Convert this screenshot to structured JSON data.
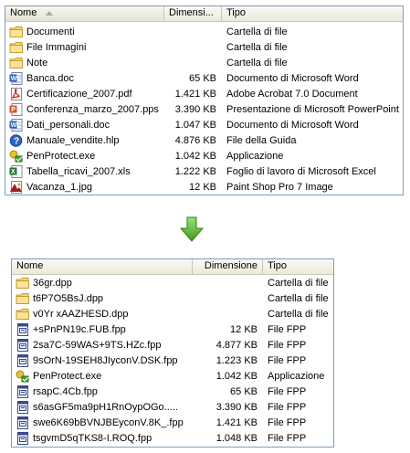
{
  "top": {
    "columns": {
      "name": "Nome",
      "size": "Dimensi...",
      "type": "Tipo"
    },
    "rows": [
      {
        "icon": "folder-icon",
        "name": "Documenti",
        "size": "",
        "type": "Cartella di file"
      },
      {
        "icon": "folder-icon",
        "name": "File Immagini",
        "size": "",
        "type": "Cartella di file"
      },
      {
        "icon": "folder-icon",
        "name": "Note",
        "size": "",
        "type": "Cartella di file"
      },
      {
        "icon": "word-doc-icon",
        "name": "Banca.doc",
        "size": "65 KB",
        "type": "Documento di Microsoft Word"
      },
      {
        "icon": "pdf-icon",
        "name": "Certificazione_2007.pdf",
        "size": "1.421 KB",
        "type": "Adobe Acrobat 7.0 Document"
      },
      {
        "icon": "powerpoint-icon",
        "name": "Conferenza_marzo_2007.pps",
        "size": "3.390 KB",
        "type": "Presentazione di Microsoft PowerPoint"
      },
      {
        "icon": "word-doc-icon",
        "name": "Dati_personali.doc",
        "size": "1.047 KB",
        "type": "Documento di Microsoft Word"
      },
      {
        "icon": "help-icon",
        "name": "Manuale_vendite.hlp",
        "size": "4.876 KB",
        "type": "File della Guida"
      },
      {
        "icon": "app-icon",
        "name": "PenProtect.exe",
        "size": "1.042 KB",
        "type": "Applicazione"
      },
      {
        "icon": "excel-icon",
        "name": "Tabella_ricavi_2007.xls",
        "size": "1.222 KB",
        "type": "Foglio di lavoro di Microsoft Excel"
      },
      {
        "icon": "image-icon",
        "name": "Vacanza_1.jpg",
        "size": "12 KB",
        "type": "Paint Shop Pro 7 Image"
      }
    ]
  },
  "bottom": {
    "columns": {
      "name": "Nome",
      "size": "Dimensione",
      "type": "Tipo"
    },
    "rows": [
      {
        "icon": "folder-icon",
        "name": "36gr.dpp",
        "size": "",
        "type": "Cartella di file"
      },
      {
        "icon": "folder-icon",
        "name": "t6P7O5BsJ.dpp",
        "size": "",
        "type": "Cartella di file"
      },
      {
        "icon": "folder-icon",
        "name": "v0Yr xAAZHESD.dpp",
        "size": "",
        "type": "Cartella di file"
      },
      {
        "icon": "fpp-file-icon",
        "name": "+sPnPN19c.FUB.fpp",
        "size": "12 KB",
        "type": "File FPP"
      },
      {
        "icon": "fpp-file-icon",
        "name": "2sa7C-59WAS+9TS.HZc.fpp",
        "size": "4.877 KB",
        "type": "File FPP"
      },
      {
        "icon": "fpp-file-icon",
        "name": "9sOrN-19SEH8JIyconV.DSK.fpp",
        "size": "1.223 KB",
        "type": "File FPP"
      },
      {
        "icon": "app-icon",
        "name": "PenProtect.exe",
        "size": "1.042 KB",
        "type": "Applicazione"
      },
      {
        "icon": "fpp-file-icon",
        "name": "rsapC.4Cb.fpp",
        "size": "65 KB",
        "type": "File FPP"
      },
      {
        "icon": "fpp-file-icon",
        "name": "s6asGF5ma9pH1RnOypOGo.....",
        "size": "3.390 KB",
        "type": "File FPP"
      },
      {
        "icon": "fpp-file-icon",
        "name": "swe6K69bBVNJBEyconV.8K_.fpp",
        "size": "1.421 KB",
        "type": "File FPP"
      },
      {
        "icon": "fpp-file-icon",
        "name": "tsgvmD5qTKS8-I.ROQ.fpp",
        "size": "1.048 KB",
        "type": "File FPP"
      }
    ]
  },
  "colors": {
    "arrow": "#5cb832",
    "border": "#7f9db9",
    "header": "#ebeadb"
  }
}
